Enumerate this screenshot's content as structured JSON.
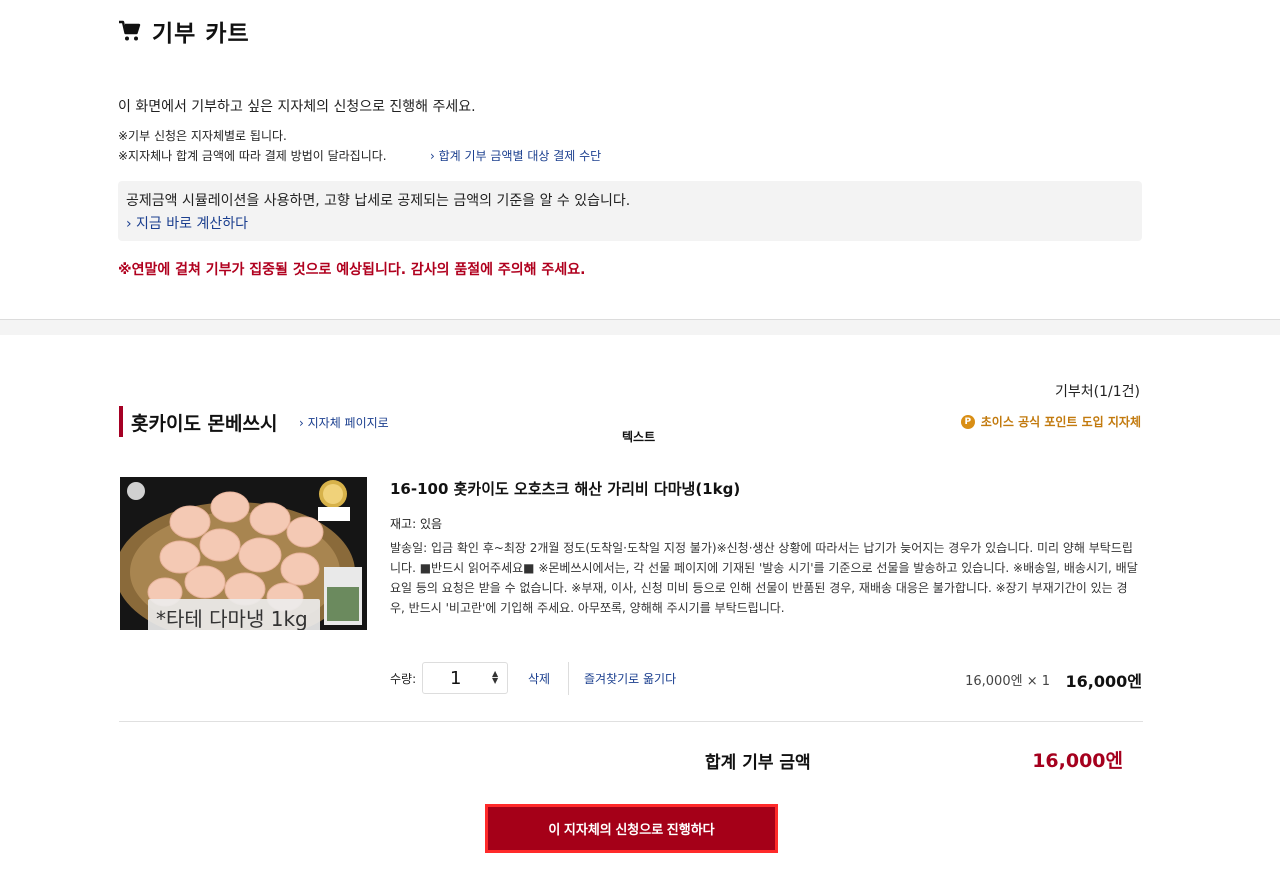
{
  "header": {
    "icon": "cart-icon",
    "title": "기부 카트"
  },
  "intro": {
    "main_text": "이 화면에서 기부하고 싶은 지자체의 신청으로 진행해 주세요.",
    "note1": "※기부 신청은 지자체별로 됩니다.",
    "note2": "※지자체나 합계 금액에 따라 결제 방법이 달라집니다.",
    "note2_link": "› 합계 기부 금액별 대상 결제 수단"
  },
  "simulation": {
    "text": "공제금액 시뮬레이션을 사용하면, 고향 납세로 공제되는 금액의 기준을 알 수 있습니다.",
    "link": "› 지금 바로 계산하다"
  },
  "warning": "※연말에 걸쳐 기부가 집중될 것으로 예상됩니다. 감사의 품절에 주의해 주세요.",
  "cart": {
    "count_label": "기부처(1/1건)",
    "municipality": {
      "name": "홋카이도 몬베쓰시",
      "link": "› 지자체 페이지로",
      "extra_text": "텍스트",
      "point_icon_letter": "P",
      "point_label": "초이스 공식 포인트 도입 지자체"
    },
    "item": {
      "image_caption": "*타테 다마냉 1kg",
      "name": "16-100 홋카이도 오호츠크 해산 가리비 다마냉(1kg)",
      "stock": "재고: 있음",
      "description": "발송일: 입금 확인 후~최장 2개월 정도(도착일·도착일 지정 불가)※신청·생산 상황에 따라서는 납기가 늦어지는 경우가 있습니다. 미리 양해 부탁드립니다. ■반드시 읽어주세요■ ※몬베쓰시에서는, 각 선물 페이지에 기재된 '발송 시기'를 기준으로 선물을 발송하고 있습니다. ※배송일, 배송시기, 배달 요일 등의 요청은 받을 수 없습니다. ※부재, 이사, 신청 미비 등으로 인해 선물이 반품된 경우, 재배송 대응은 불가합니다. ※장기 부재기간이 있는 경우, 반드시 '비고란'에 기입해 주세요. 아무쪼록, 양해해 주시기를 부탁드립니다.",
      "qty_label": "수량:",
      "qty_value": "1",
      "delete_label": "삭제",
      "favorite_label": "즐겨찾기로 옮기다",
      "unit_price": "16,000엔 × 1",
      "line_total": "16,000엔"
    },
    "total_label": "합계 기부 금액",
    "total_value": "16,000엔",
    "proceed_button": "이 지자체의 신청으로 진행하다"
  },
  "colors": {
    "accent": "#a50018",
    "link": "#1b3f8f",
    "warning": "#b0001e",
    "point": "#d98e14"
  }
}
